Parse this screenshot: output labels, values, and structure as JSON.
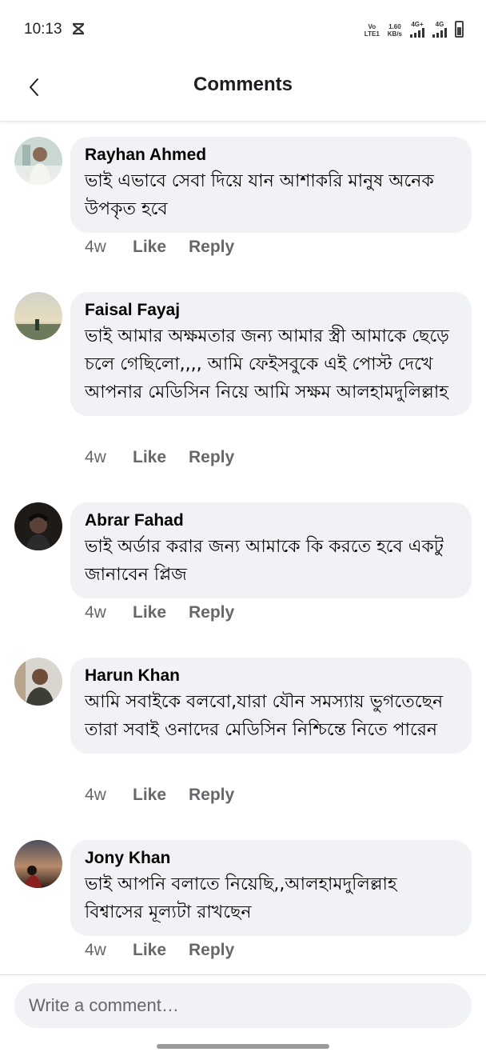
{
  "status": {
    "time": "10:13",
    "volte_top": "Vo",
    "volte_bottom": "LTE1",
    "speed_top": "1.60",
    "speed_bottom": "KB/s",
    "net1": "4G+",
    "net2": "4G"
  },
  "header": {
    "title": "Comments"
  },
  "comments": [
    {
      "name": "Rayhan Ahmed",
      "text": "ভাই এভাবে সেবা দিয়ে যান আশাকরি মানুষ অনেক উপকৃত হবে",
      "ago": "4w",
      "like": "Like",
      "reply": "Reply"
    },
    {
      "name": "Faisal Fayaj",
      "text": "ভাই আমার অক্ষমতার জন্য আমার স্ত্রী আমাকে ছেড়ে চলে গেছিলো,,,, আমি ফেইসবুকে এই পোস্ট দেখে আপনার মেডিসিন নিয়ে আমি সক্ষম আলহামদুলিল্লাহ",
      "ago": "4w",
      "like": "Like",
      "reply": "Reply"
    },
    {
      "name": "Abrar Fahad",
      "text": "ভাই অর্ডার করার জন্য আমাকে কি করতে হবে একটু জানাবেন প্লিজ",
      "ago": "4w",
      "like": "Like",
      "reply": "Reply"
    },
    {
      "name": "Harun Khan",
      "text": "আমি সবাইকে বলবো,যারা যৌন সমস্যায় ভুগতেছেন তারা সবাই ওনাদের মেডিসিন নিশ্চিন্তে নিতে পারেন",
      "ago": "4w",
      "like": "Like",
      "reply": "Reply"
    },
    {
      "name": "Jony Khan",
      "text": "ভাই আপনি বলাতে নিয়েছি,,আলহামদুলিল্লাহ বিশ্বাসের মূল্যটা রাখছেন",
      "ago": "4w",
      "like": "Like",
      "reply": "Reply"
    }
  ],
  "composer": {
    "placeholder": "Write a comment…"
  }
}
